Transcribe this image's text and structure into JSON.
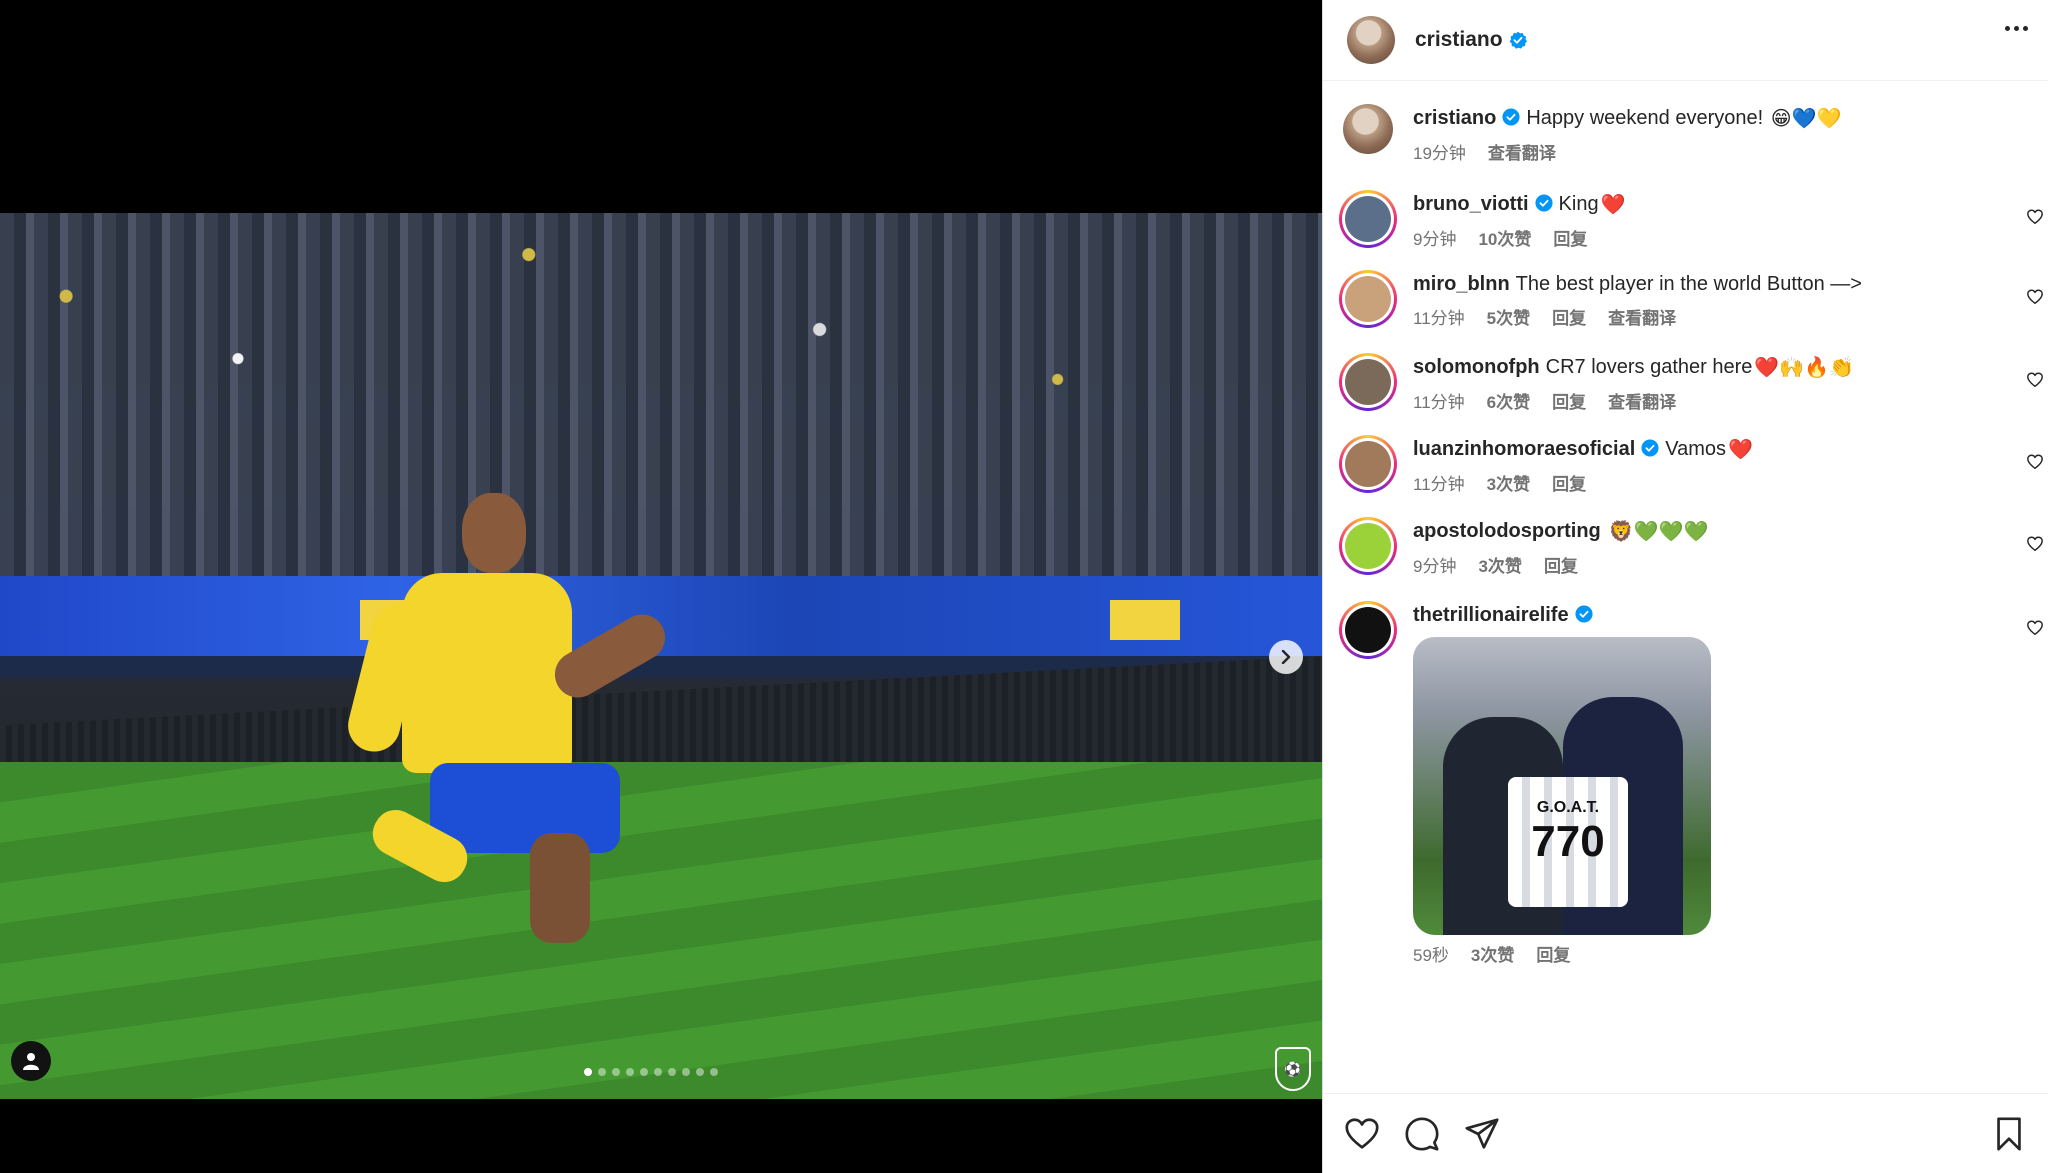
{
  "post": {
    "author": "cristiano",
    "verified": true,
    "carousel": {
      "count": 10,
      "active_index": 0
    }
  },
  "caption": {
    "username": "cristiano",
    "text": "Happy weekend everyone!",
    "emojis": "😁💙💛",
    "time": "19分钟",
    "translate": "查看翻译"
  },
  "comments": [
    {
      "username": "bruno_viotti",
      "verified": true,
      "text": "King",
      "emojis": "❤️",
      "time": "9分钟",
      "likes": "10次赞",
      "reply": "回复",
      "translate": ""
    },
    {
      "username": "miro_blnn",
      "verified": false,
      "text": "The best player in the world Button —>",
      "emojis": "",
      "time": "11分钟",
      "likes": "5次赞",
      "reply": "回复",
      "translate": "查看翻译"
    },
    {
      "username": "solomonofph",
      "verified": false,
      "text": "CR7 lovers gather here",
      "emojis": "❤️🙌🔥👏",
      "time": "11分钟",
      "likes": "6次赞",
      "reply": "回复",
      "translate": "查看翻译"
    },
    {
      "username": "luanzinhomoraesoficial",
      "verified": true,
      "text": "Vamos",
      "emojis": "❤️",
      "time": "11分钟",
      "likes": "3次赞",
      "reply": "回复",
      "translate": ""
    },
    {
      "username": "apostolodosporting",
      "verified": false,
      "text": "",
      "emojis": "🦁💚💚💚",
      "time": "9分钟",
      "likes": "3次赞",
      "reply": "回复",
      "translate": ""
    },
    {
      "username": "thetrillionairelife",
      "verified": true,
      "text": "",
      "emojis": "",
      "time": "59秒",
      "likes": "3次赞",
      "reply": "回复",
      "translate": "",
      "attachment": {
        "shirt_name": "G.O.A.T.",
        "shirt_number": "770"
      }
    }
  ],
  "icons": {
    "more": "more-options-icon",
    "like": "heart-icon",
    "comment": "comment-icon",
    "share": "share-icon",
    "save": "bookmark-icon",
    "next": "chevron-right-icon",
    "tags": "person-tag-icon",
    "verified": "verified-badge-icon"
  },
  "colors": {
    "verified": "#0095f6",
    "text": "#262626",
    "meta": "#737373"
  }
}
